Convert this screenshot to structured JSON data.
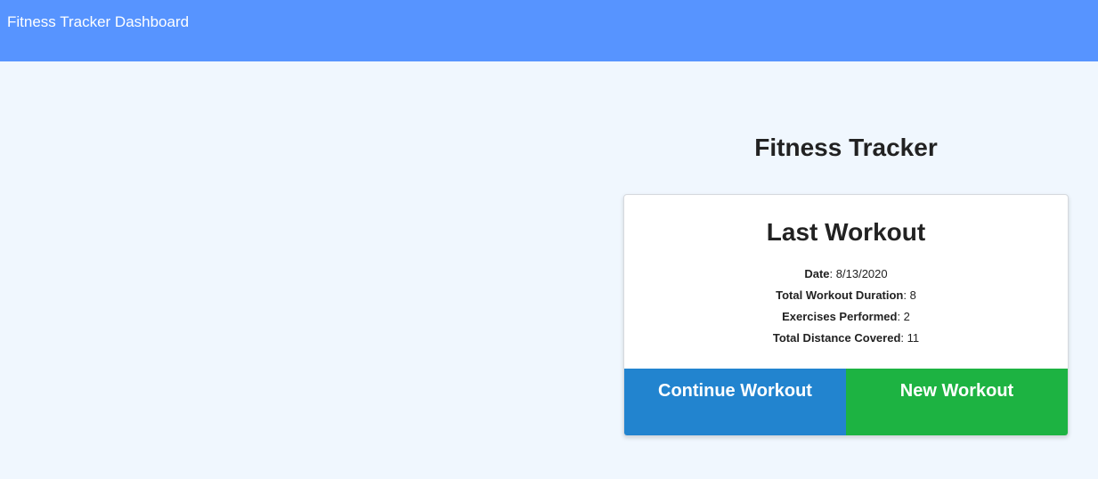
{
  "header": {
    "title": "Fitness Tracker Dashboard",
    "color": "#5794ff"
  },
  "main": {
    "title": "Fitness Tracker"
  },
  "card": {
    "title": "Last Workout",
    "stats": [
      {
        "label": "Date",
        "value": "8/13/2020"
      },
      {
        "label": "Total Workout Duration",
        "value": "8"
      },
      {
        "label": "Exercises Performed",
        "value": "2"
      },
      {
        "label": "Total Distance Covered",
        "value": "11"
      }
    ],
    "buttons": {
      "continue_label": "Continue Workout",
      "continue_color": "#2284cf",
      "new_label": "New Workout",
      "new_color": "#1db342"
    }
  }
}
